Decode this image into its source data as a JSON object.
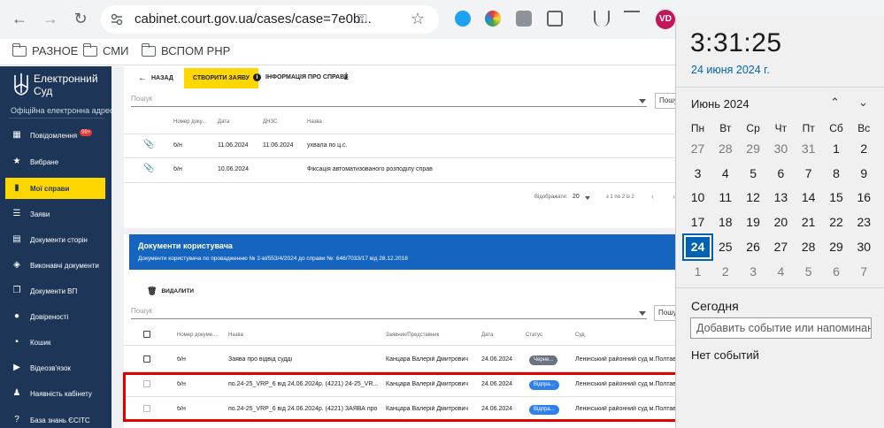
{
  "browser": {
    "url": "cabinet.court.gov.ua/cases/case=7e0b...",
    "avatar_initials": "VD",
    "bookmarks": [
      "РАЗНОЕ",
      "СМИ",
      "ВСПОМ PHP"
    ]
  },
  "sidebar": {
    "brand_line1": "Електронний",
    "brand_line2": "Суд",
    "subtitle": "Офіційна електронна адреса",
    "badge": "99+",
    "items": [
      {
        "label": "Повідомлення",
        "icon": "message-icon"
      },
      {
        "label": "Вибране",
        "icon": "star-icon"
      },
      {
        "label": "Мої справи",
        "icon": "folder-icon"
      },
      {
        "label": "Заяви",
        "icon": "list-icon"
      },
      {
        "label": "Документи сторін",
        "icon": "document-icon"
      },
      {
        "label": "Виконавчі документи",
        "icon": "layers-icon"
      },
      {
        "label": "Документи ВП",
        "icon": "copy-icon"
      },
      {
        "label": "Довіреності",
        "icon": "users-icon"
      },
      {
        "label": "Кошик",
        "icon": "trash-icon"
      },
      {
        "label": "Відеозв'язок",
        "icon": "video-icon"
      },
      {
        "label": "Наявність кабінету",
        "icon": "person-icon"
      },
      {
        "label": "База знань ЄСІТС",
        "icon": "help-icon"
      }
    ]
  },
  "case_panel": {
    "back_label": "НАЗАД",
    "create_label": "СТВОРИТИ ЗАЯВУ",
    "info_label": "ІНФОРМАЦІЯ ПРО СПРАВУ",
    "search_placeholder": "Пошук",
    "search_btn": "Пошук",
    "columns": [
      "Номер доку...",
      "Дата",
      "ДНЗС",
      "Назва"
    ],
    "rows": [
      {
        "number": "б/н",
        "date": "11.06.2024",
        "dnzs": "11.06.2024",
        "name": "ухвала по ц.с."
      },
      {
        "number": "б/н",
        "date": "10.06.2024",
        "dnzs": "",
        "name": "Фіксація автоматизованого розподілу справ"
      }
    ],
    "pagination": {
      "label": "Відображати:",
      "per_page": "20",
      "range": "з 1 по 2 із 2"
    }
  },
  "user_docs": {
    "title": "Документи користувача",
    "subtitle": "Документи користувача по провадженню № 2-ві/553/4/2024 до справи №: 646/7033/17 від 28.12.2018",
    "delete_label": "ВИДАЛИТИ",
    "search_placeholder": "Пошук",
    "search_btn": "Пошук",
    "columns": [
      "Номер докуме...",
      "Назва",
      "Заявник/Представник",
      "Дата",
      "Статус",
      "Суд"
    ],
    "rows": [
      {
        "number": "б/н",
        "name": "Заява про відвід судді",
        "applicant": "Канцара Валерій Дмитрович",
        "date": "24.06.2024",
        "status": "Черне...",
        "court": "Ленінський районний суд м.Полтави"
      },
      {
        "number": "б/н",
        "name": "по.24-25_VRP_6 від 24.06.2024р. (4221) 24-25_VR...",
        "applicant": "Канцара Валерій Дмитрович",
        "date": "24.06.2024",
        "status": "Відпра...",
        "court": "Ленінський районний суд м.Полтави"
      },
      {
        "number": "б/н",
        "name": "по.24-25_VRP_6 від 24.06.2024р. (4221) ЗАЯВА про к...",
        "applicant": "Канцара Валерій Дмитрович",
        "date": "24.06.2024",
        "status": "Відпра...",
        "court": "Ленінський районний суд м.Полтави"
      }
    ]
  },
  "calendar": {
    "time": "3:31:25",
    "date_text": "24 июня 2024 г.",
    "month_label": "Июнь 2024",
    "weekdays": [
      "Пн",
      "Вт",
      "Ср",
      "Чт",
      "Пт",
      "Сб",
      "Вс"
    ],
    "weeks": [
      [
        "27",
        "28",
        "29",
        "30",
        "31",
        "1",
        "2"
      ],
      [
        "3",
        "4",
        "5",
        "6",
        "7",
        "8",
        "9"
      ],
      [
        "10",
        "11",
        "12",
        "13",
        "14",
        "15",
        "16"
      ],
      [
        "17",
        "18",
        "19",
        "20",
        "21",
        "22",
        "23"
      ],
      [
        "24",
        "25",
        "26",
        "27",
        "28",
        "29",
        "30"
      ],
      [
        "1",
        "2",
        "3",
        "4",
        "5",
        "6",
        "7"
      ]
    ],
    "today_label": "Сегодня",
    "event_placeholder": "Добавить событие или напоминание",
    "no_events": "Нет событий",
    "colors": {
      "accent": "#0063b1"
    }
  }
}
